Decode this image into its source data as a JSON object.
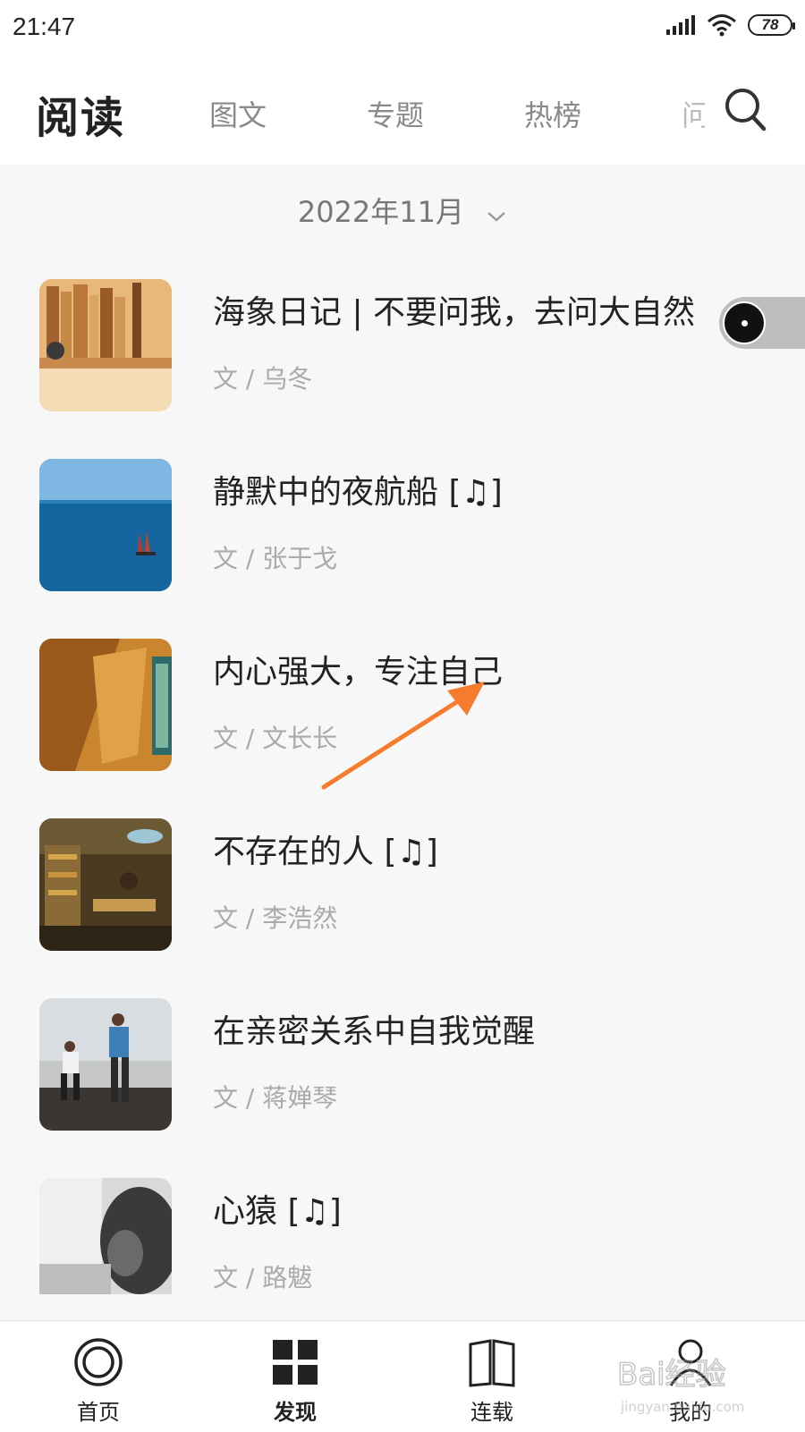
{
  "status": {
    "time": "21:47",
    "battery": "78"
  },
  "nav": {
    "title": "阅读",
    "tabs": [
      {
        "label": "图文"
      },
      {
        "label": "专题"
      },
      {
        "label": "热榜"
      },
      {
        "label": "问"
      }
    ]
  },
  "month_selector": {
    "label": "2022年11月"
  },
  "articles": [
    {
      "title": "海象日记 | 不要问我，去问大自然",
      "author": "文 / 乌冬"
    },
    {
      "title": "静默中的夜航船 [♫]",
      "author": "文 / 张于戈"
    },
    {
      "title": "内心强大，专注自己",
      "author": "文 / 文长长"
    },
    {
      "title": "不存在的人 [♫]",
      "author": "文 / 李浩然"
    },
    {
      "title": "在亲密关系中自我觉醒",
      "author": "文 / 蒋婵琴"
    },
    {
      "title": "心猿 [♫]",
      "author": "文 / 路魃"
    }
  ],
  "bottom_nav": [
    {
      "label": "首页",
      "icon": "home-ring-icon"
    },
    {
      "label": "发现",
      "icon": "grid-icon"
    },
    {
      "label": "连载",
      "icon": "book-icon"
    },
    {
      "label": "我的",
      "icon": "user-icon"
    }
  ],
  "colors": {
    "annotation_arrow": "#f47c2c",
    "background": "#f7f7f7"
  },
  "watermark": {
    "text": "Bai经验",
    "sub": "jingyan.baidu.com"
  }
}
